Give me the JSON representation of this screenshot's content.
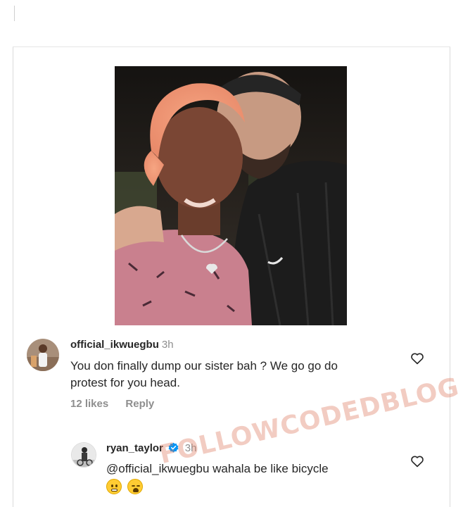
{
  "comments": [
    {
      "username": "official_ikwuegbu",
      "time": "3h",
      "text_line1": "You don finally dump our sister bah ? We go go do",
      "text_line2": "protest for you head.",
      "likes": "12 likes",
      "reply_label": "Reply"
    },
    {
      "username": "ryan_taylor",
      "verified": true,
      "time": "3h",
      "mention": "@official_ikwuegbu",
      "text": " wahala be like bicycle",
      "emojis": [
        "grimacing-face",
        "weary-face"
      ]
    }
  ],
  "watermark": "FOLLOWCODEDBLOG",
  "colors": {
    "verified": "#0095f6",
    "muted": "#8e8e8e",
    "text": "#262626"
  }
}
